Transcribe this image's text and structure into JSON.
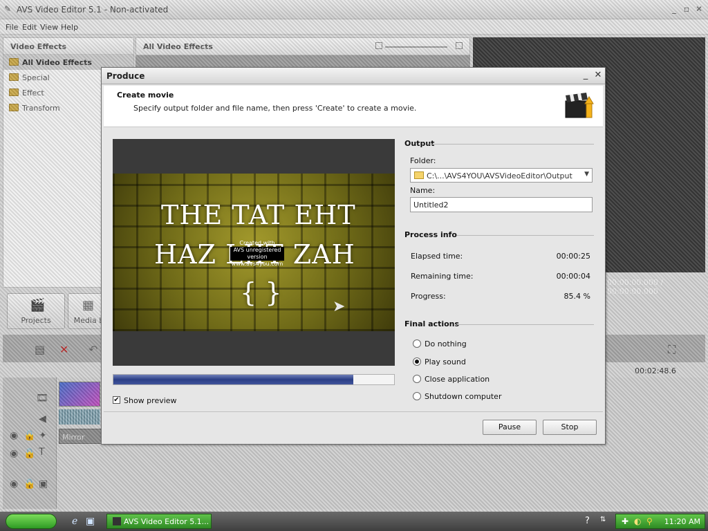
{
  "app": {
    "title": "AVS Video Editor 5.1 - Non-activated",
    "menu": [
      "File",
      "Edit",
      "View",
      "Help"
    ],
    "effects_panel": {
      "header": "Video Effects",
      "items": [
        "All Video Effects",
        "Special",
        "Effect",
        "Transform"
      ]
    },
    "gallery_header": "All Video Effects",
    "timecode": "00:00:00.000 / 00:00:00.000",
    "buttons": [
      "Projects",
      "Media L"
    ],
    "timeline_time": "00:02:48.6",
    "track_clip": "Mirror"
  },
  "dialog": {
    "title": "Produce",
    "header_title": "Create movie",
    "header_subtitle": "Specify output folder and file name, then press 'Create' to create a movie.",
    "preview": {
      "line1": "THE TAT EHT",
      "line2": "HAZ LIIT ZAH",
      "braces": "{ }",
      "watermark_top": "Created with",
      "watermark_mid": "AVS unregistered version",
      "watermark_bottom": "www.avs4you.com"
    },
    "progress_fraction": 0.854,
    "show_preview": {
      "label": "Show preview",
      "checked": true
    },
    "output": {
      "section": "Output",
      "folder_label": "Folder:",
      "folder_value": "C:\\...\\AVS4YOU\\AVSVideoEditor\\Output",
      "name_label": "Name:",
      "name_value": "Untitled2"
    },
    "process_info": {
      "section": "Process info",
      "elapsed_label": "Elapsed time:",
      "elapsed_value": "00:00:25",
      "remaining_label": "Remaining time:",
      "remaining_value": "00:00:04",
      "progress_label": "Progress:",
      "progress_value": "85.4 %"
    },
    "final_actions": {
      "section": "Final actions",
      "options": [
        "Do nothing",
        "Play sound",
        "Close application",
        "Shutdown computer"
      ],
      "selected": "Play sound"
    },
    "buttons": {
      "pause": "Pause",
      "stop": "Stop"
    }
  },
  "taskbar": {
    "task_label": "AVS Video Editor 5.1...",
    "clock": "11:20 AM"
  }
}
